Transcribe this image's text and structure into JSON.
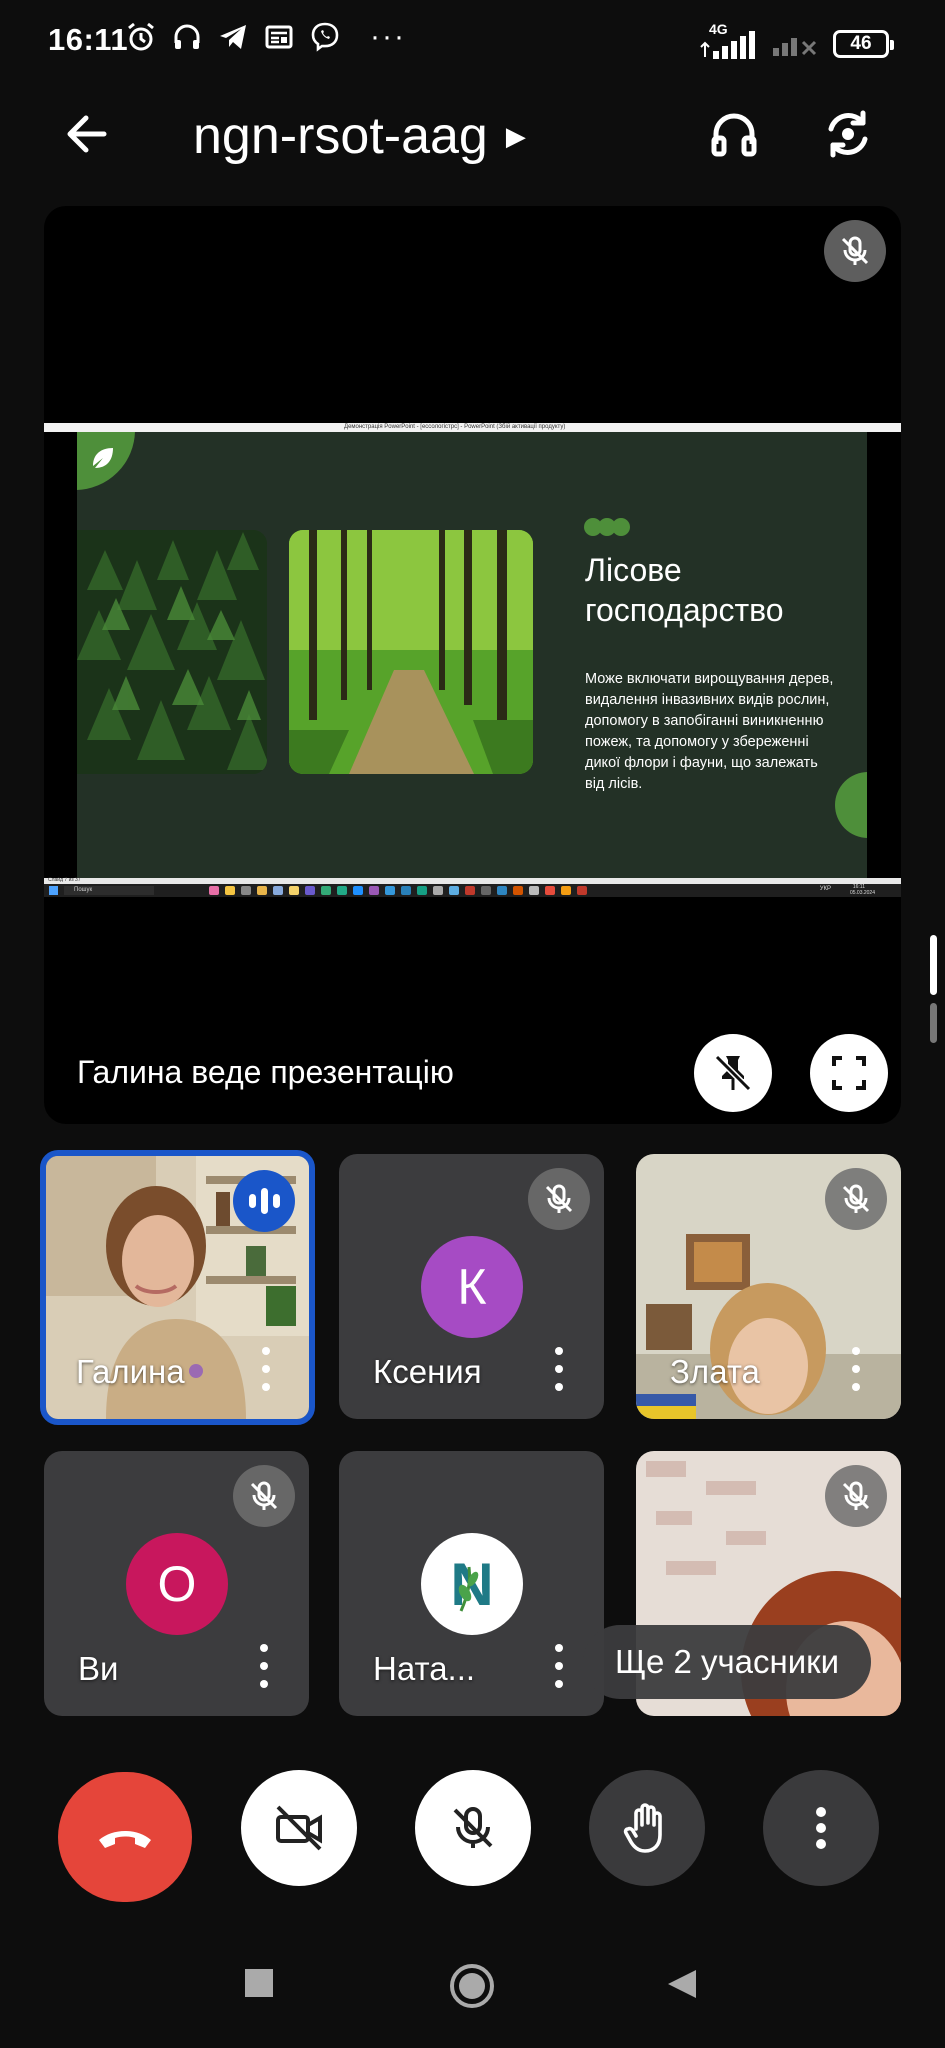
{
  "status_bar": {
    "time": "16:11",
    "network": "4G",
    "battery": "46",
    "icons": [
      "alarm-icon",
      "headset-icon",
      "telegram-icon",
      "news-icon",
      "viber-icon"
    ]
  },
  "header": {
    "title": "ngn-rsot-aag",
    "icons": [
      "back-arrow-icon",
      "chevron-right-icon",
      "headphones-icon",
      "switch-camera-icon"
    ]
  },
  "presentation": {
    "window_title": "Демонстрація PowerPoint - [ессологістрс] - PowerPoint (Збій активації продукту)",
    "slide": {
      "title_line1": "Лісове",
      "title_line2": "господарство",
      "body": "Може включати вирощування дерев, видалення інвазивних видів рослин, допомогу в запобіганні виникненню пожеж, та допомогу у збереженні дикої флори і фауни, що залежать від лісів."
    },
    "slide_counter": "Слайд 7 из 37",
    "taskbar_search": "Пошук",
    "tray_lang": "УКР",
    "tray_time": "16:11",
    "tray_date": "05.03.2024",
    "presenter_label": "Галина веде презентацію"
  },
  "participants": [
    {
      "name": "Галина",
      "type": "video",
      "speaking": true,
      "muted": false
    },
    {
      "name": "Ксения",
      "type": "avatar",
      "initial": "К",
      "color": "#a64bc4",
      "muted": true
    },
    {
      "name": "Злата",
      "type": "video",
      "muted": true
    },
    {
      "name": "Ви",
      "type": "avatar",
      "initial": "О",
      "color": "#c8175d",
      "muted": true
    },
    {
      "name": "Ната...",
      "type": "avatar",
      "initial": "N",
      "color": "#ffffff",
      "muted": false
    },
    {
      "name": "",
      "type": "video",
      "muted": true
    }
  ],
  "more_participants": "Ще 2 учасники",
  "controls": [
    "end-call",
    "camera-off",
    "mic-off",
    "raise-hand",
    "more-options"
  ],
  "colors": {
    "accent_blue": "#1a56c9",
    "end_call_red": "#e5453a",
    "slide_bg": "#233126",
    "slide_green": "#4e8f3a"
  }
}
